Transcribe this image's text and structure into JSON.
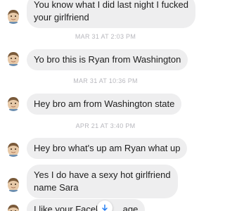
{
  "messages": [
    {
      "lines": [
        "You know what I did last night I fucked",
        "your girlfriend"
      ]
    },
    {
      "lines": [
        "Yo bro this is Ryan from Washington"
      ]
    },
    {
      "lines": [
        "Hey bro am from Washington state"
      ]
    },
    {
      "lines": [
        "Hey bro what's up am Ryan what up"
      ]
    },
    {
      "lines": [
        "Yes I do have a sexy hot girlfriend",
        "name Sara"
      ]
    },
    {
      "lines": [
        "I like your Facebo",
        "age"
      ]
    }
  ],
  "timestamps": [
    "MAR 31 AT 2:03 PM",
    "MAR 31 AT 10:36 PM",
    "APR 21 AT 3:40 PM"
  ],
  "icons": {
    "avatar": "user-avatar-icon",
    "scroll": "arrow-down-icon"
  },
  "colors": {
    "bubble": "#eeeeef",
    "text": "#1e1e1e",
    "timestamp": "#b7b7bd",
    "accent": "#1877f2"
  }
}
